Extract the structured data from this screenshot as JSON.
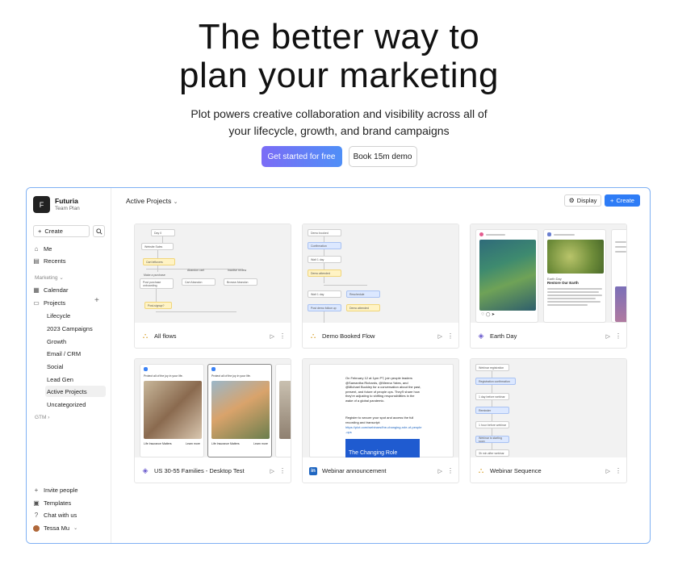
{
  "hero": {
    "title_line1": "The better way to",
    "title_line2": "plan your marketing",
    "subtitle_line1": "Plot powers creative collaboration and visibility across all of",
    "subtitle_line2": "your lifecycle, growth, and brand campaigns",
    "primary_cta": "Get started for free",
    "secondary_cta": "Book 15m demo",
    "accent_gradient": [
      "#7b6cf6",
      "#4f8ff7"
    ]
  },
  "sidebar": {
    "workspace_initial": "F",
    "workspace_name": "Futuria",
    "workspace_plan": "Team Plan",
    "create_label": "Create",
    "me": "Me",
    "recents": "Recents",
    "marketing_label": "Marketing",
    "calendar": "Calendar",
    "projects": "Projects",
    "project_items": [
      "Lifecycle",
      "2023 Campaigns",
      "Growth",
      "Email / CRM",
      "Social",
      "Lead Gen",
      "Active Projects",
      "Uncategorized"
    ],
    "active_item": "Active Projects",
    "gtm_label": "GTM",
    "invite": "Invite people",
    "templates": "Templates",
    "chat": "Chat with us",
    "user": "Tessa Mu"
  },
  "main": {
    "title": "Active Projects",
    "display_label": "Display",
    "create_label": "Create",
    "accent": "#2e7cf6",
    "cards": [
      {
        "name": "All flows",
        "icon": "flow-icon"
      },
      {
        "name": "Demo Booked Flow",
        "icon": "flow-icon"
      },
      {
        "name": "Earth Day",
        "icon": "campaign-icon"
      },
      {
        "name": "US 30-55 Families - Desktop Test",
        "icon": "campaign-icon"
      },
      {
        "name": "Webinar announcement",
        "icon": "linkedin-icon"
      },
      {
        "name": "Webinar Sequence",
        "icon": "flow-icon"
      }
    ]
  },
  "thumbs": {
    "flow1": [
      "Day 0",
      "Website Sales",
      "Cart leftovers",
      "Make a purchase",
      "Abandon cart",
      "Inactive review",
      "Post purchase onboarding",
      "Cart Abandon",
      "Browse Abandon",
      "Post-signup?"
    ],
    "flow2": [
      "Demo booked",
      "Confirmation",
      "Wait 1 day",
      "Demo attended",
      "Wait 1 day",
      "Reschedule",
      "Post demo follow up",
      "Demo attended"
    ],
    "webinar_text": "On February 12 at 1pm PT, join people leaders @Samantha Richards, @Meena Yates, and @Michael Buckley for a conversation about the past, present, and future of people ops. They'll share how they're adjusting to shifting responsibilities in the wake of a global pandemic.",
    "webinar_text2": "Register to secure your spot and access the full recording and transcript:",
    "webinar_link": "https://plot.com/webinars/the-changing-role-of-people-ops",
    "webinar_banner": "The Changing Role",
    "seq": [
      "Webinar registration",
      "Registration confirmation",
      "1 day before webinar",
      "Reminder",
      "1 hour before webinar",
      "Webinar is starting soon",
      "3h min after webinar"
    ],
    "earth_caption": "Earth Day",
    "earth_headline": "Restore Our Earth",
    "fam_header": "Protect all of the joy in your life.",
    "fam_label": "Life Insurance Matters",
    "fam_learn": "Learn more"
  }
}
